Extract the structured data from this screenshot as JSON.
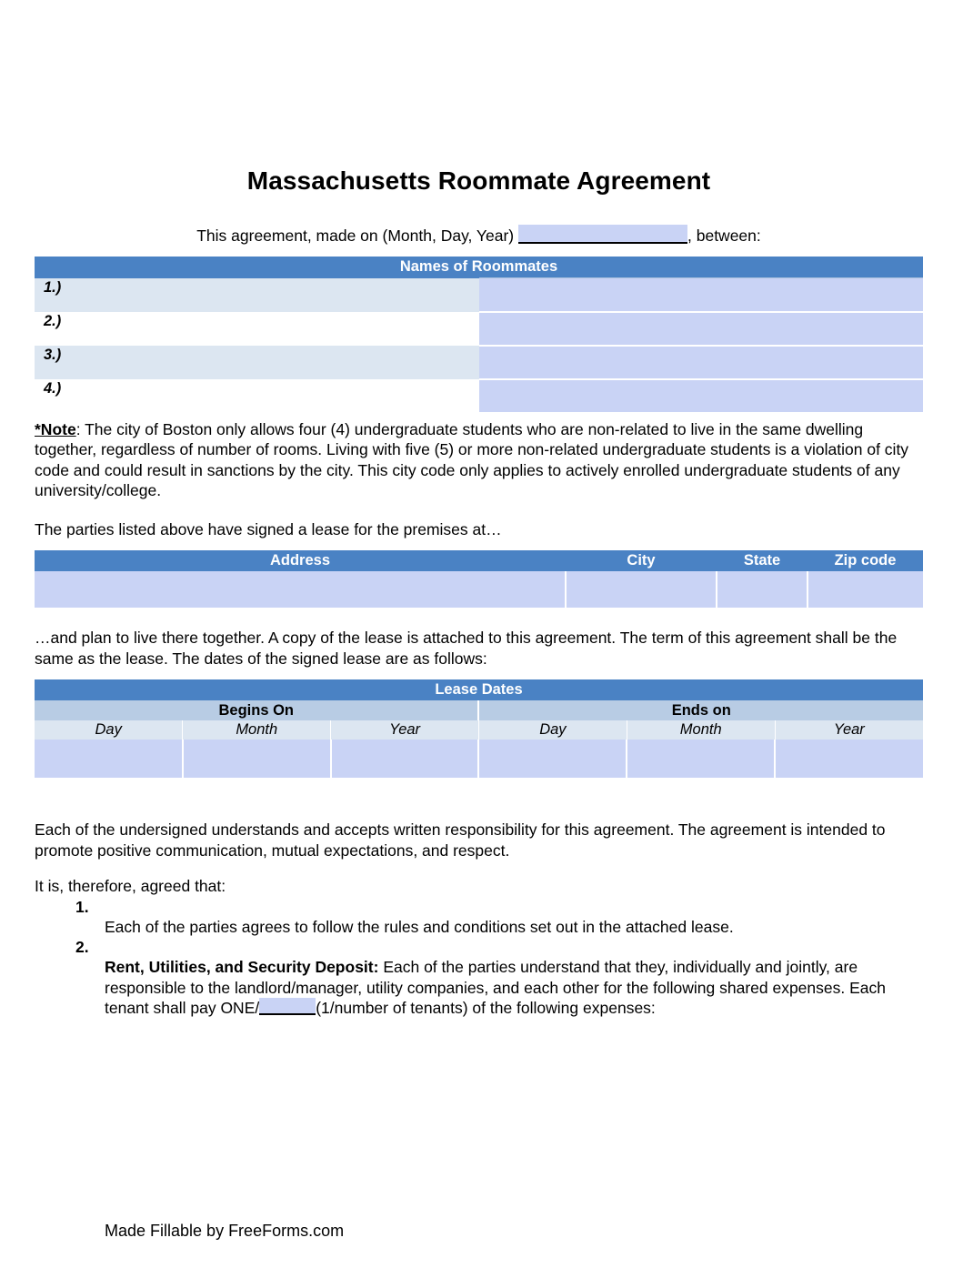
{
  "document": {
    "title": "Massachusetts Roommate Agreement",
    "intro_prefix": "This agreement, made on (Month, Day, Year)",
    "intro_suffix": ", between:"
  },
  "colors": {
    "header_blue": "#4a82c4",
    "subheader_blue": "#b8cce4",
    "subheader_light": "#dce6f1",
    "field_fill": "#c9d3f5",
    "text": "#000000",
    "header_text": "#ffffff"
  },
  "roommates_table": {
    "header": "Names of Roommates",
    "rows": [
      {
        "number": "1.)"
      },
      {
        "number": "2.)"
      },
      {
        "number": "3.)"
      },
      {
        "number": "4.)"
      }
    ]
  },
  "note": {
    "label": "*Note",
    "text": ": The city of Boston only allows four (4) undergraduate students who are non-related to live in the same dwelling together, regardless of number of rooms. Living with five (5) or more non-related undergraduate students is a violation of city code and could result in sanctions by the city.  This city code only applies to actively enrolled undergraduate students of any university/college."
  },
  "premises_intro": "The parties listed above have signed a lease for the premises at…",
  "address_table": {
    "columns": [
      "Address",
      "City",
      "State",
      "Zip code"
    ]
  },
  "lease_intro": "…and plan to live there together. A copy of the lease is attached to this agreement. The term of this agreement shall be the same as the lease. The dates of the signed lease are as follows:",
  "lease_table": {
    "header": "Lease Dates",
    "groups": [
      "Begins On",
      "Ends on"
    ],
    "subcolumns": [
      "Day",
      "Month",
      "Year",
      "Day",
      "Month",
      "Year"
    ]
  },
  "undersigned_para": "Each of the undersigned understands and accepts written responsibility for this agreement. The agreement is intended to promote positive communication, mutual expectations, and respect.",
  "agreed_para": "It is, therefore, agreed that:",
  "terms": [
    {
      "number": "1.",
      "text": "Each of the parties agrees to follow the rules and conditions set out in the attached lease."
    },
    {
      "number": "2.",
      "bold_lead": "Rent, Utilities, and Security Deposit:",
      "text_before_blank": " Each of the parties understand that they, individually and jointly, are responsible to the landlord/manager, utility companies, and each other for the following shared expenses. Each tenant shall pay ONE/",
      "text_after_blank": "(1/number of tenants) of the following expenses:"
    }
  ],
  "footer": {
    "text": "Made Fillable by FreeForms.com"
  }
}
